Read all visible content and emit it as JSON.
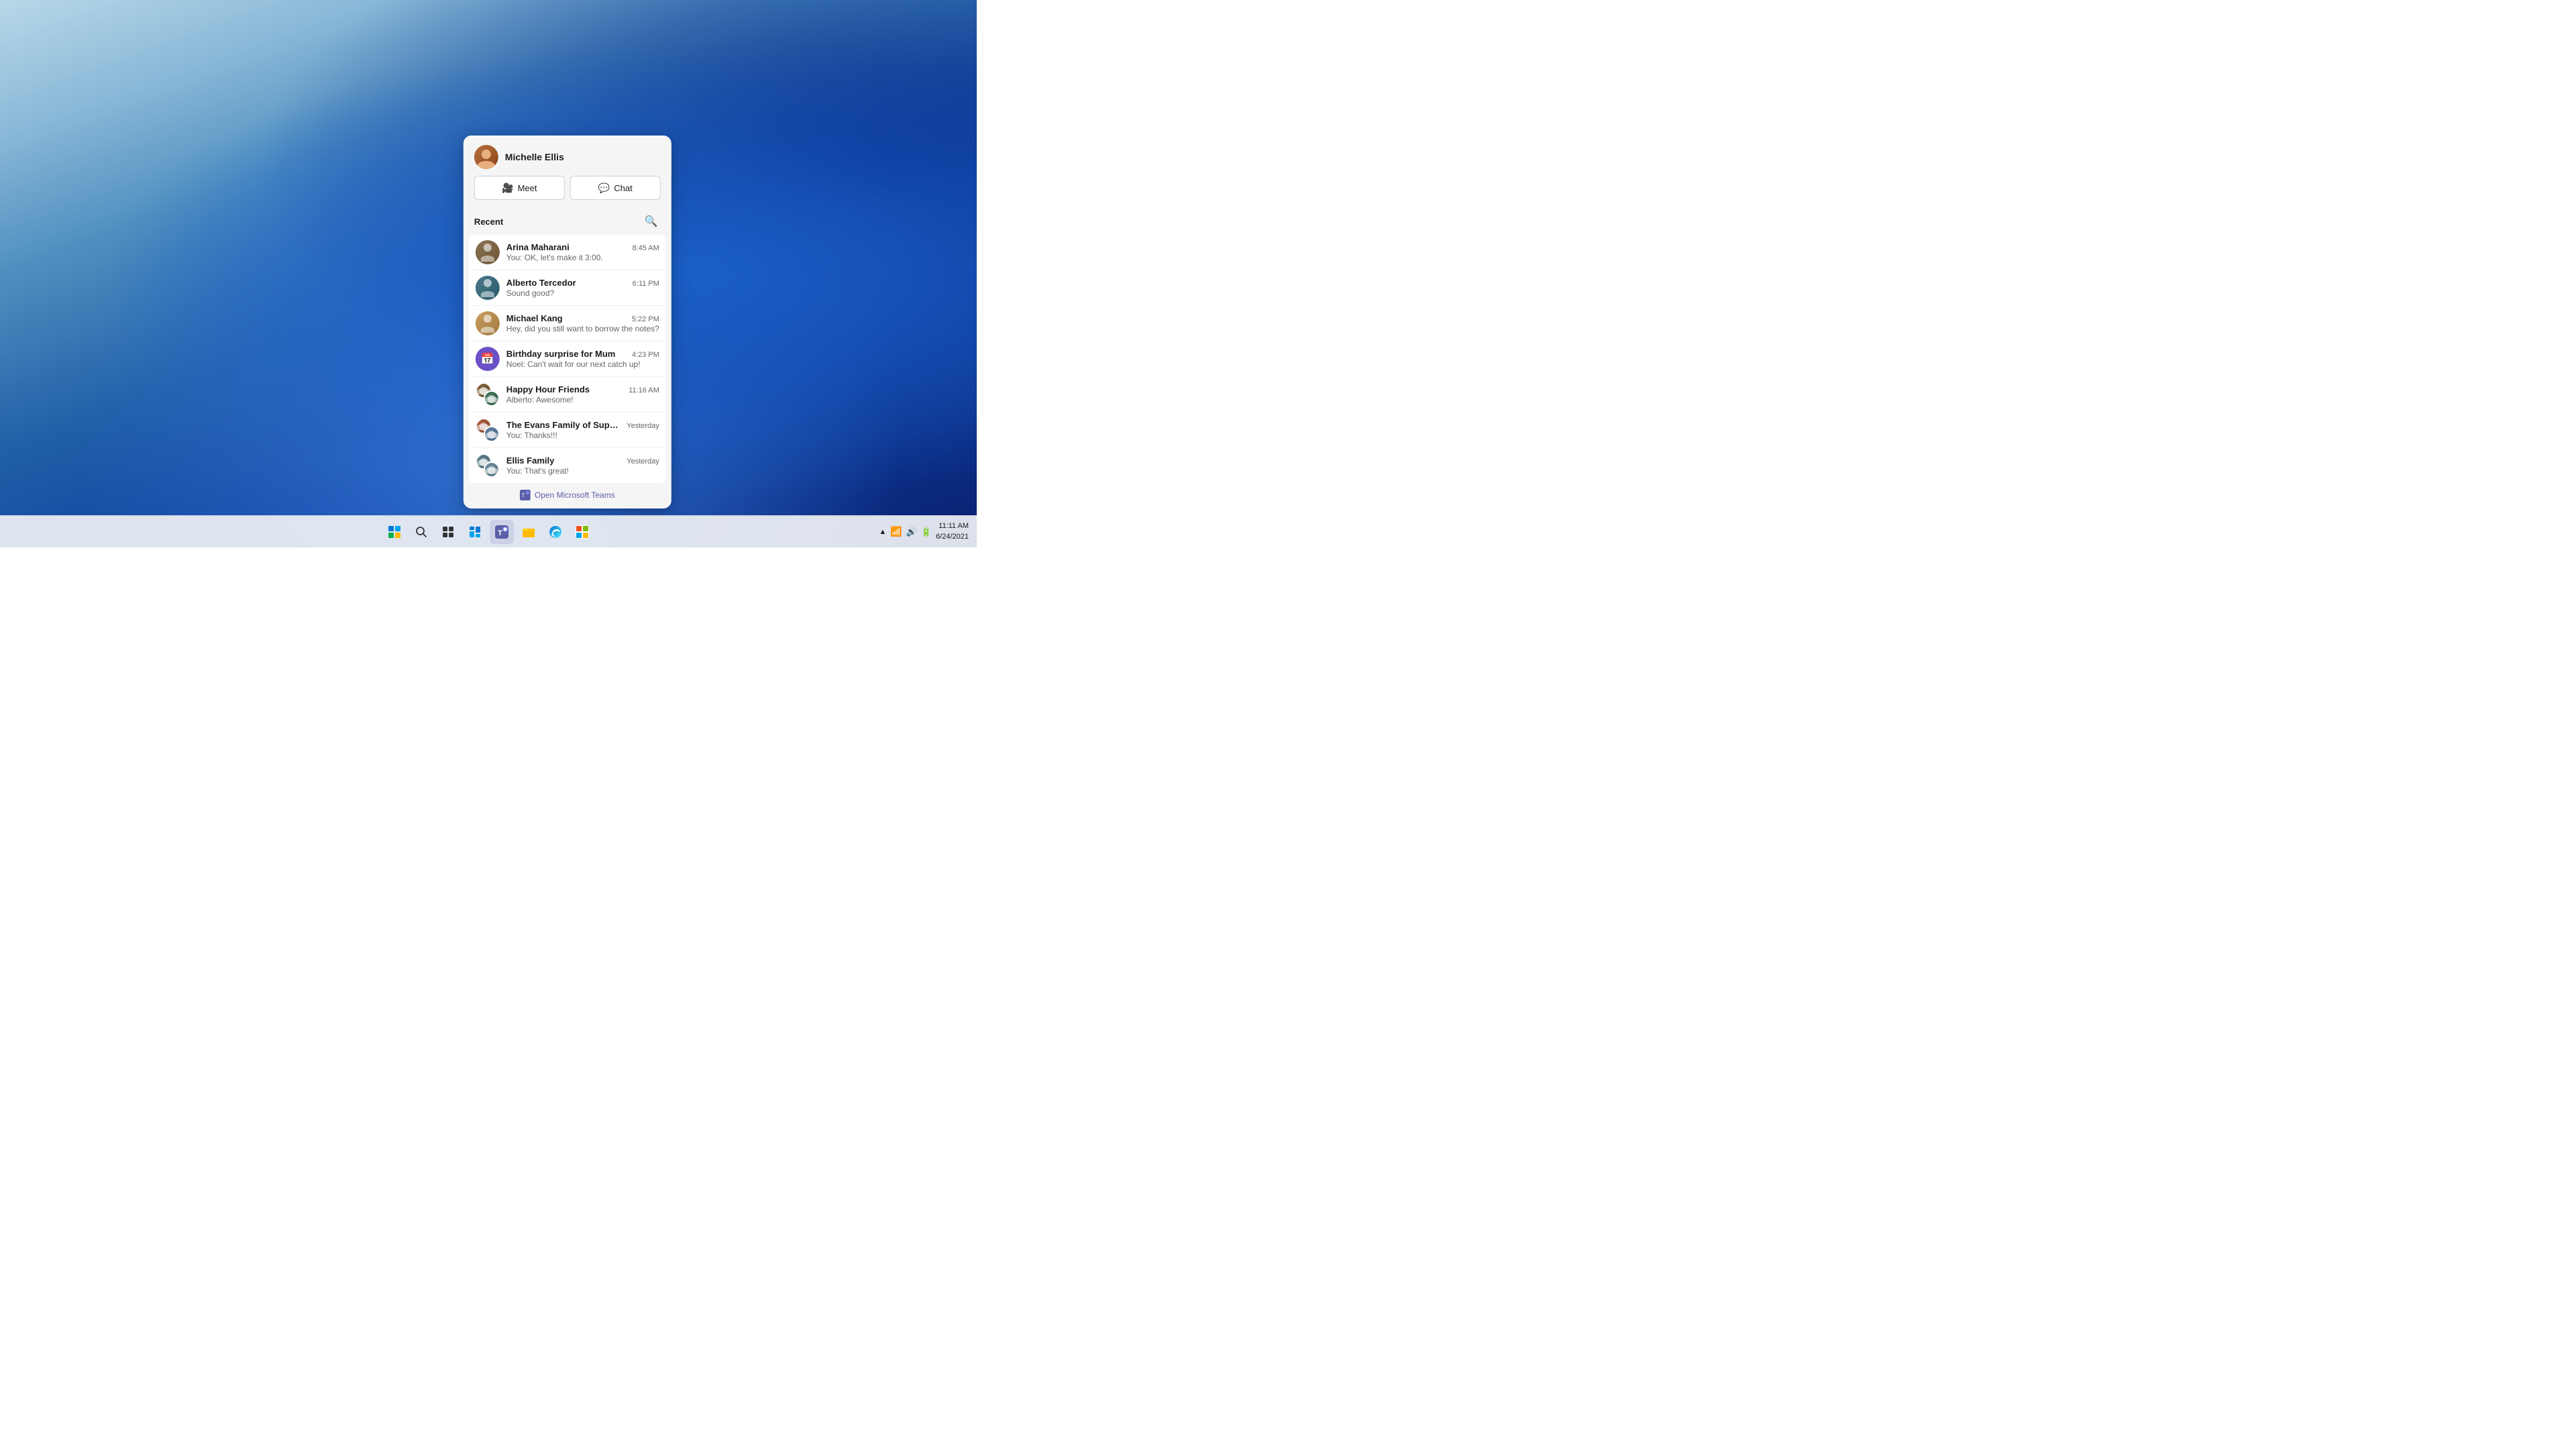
{
  "desktop": {
    "wallpaper_description": "Windows 11 blue flower wallpaper"
  },
  "teams_popup": {
    "user": {
      "name": "Michelle Ellis"
    },
    "buttons": {
      "meet_label": "Meet",
      "chat_label": "Chat"
    },
    "recent_label": "Recent",
    "chat_items": [
      {
        "id": "arina",
        "name": "Arina Maharani",
        "preview": "You: OK, let's make it 3:00.",
        "time": "8:45 AM",
        "avatar_type": "single",
        "avatar_color": "av-arina"
      },
      {
        "id": "alberto-t",
        "name": "Alberto Tercedor",
        "preview": "Sound good?",
        "time": "6:11 PM",
        "avatar_type": "single",
        "avatar_color": "av-alberto"
      },
      {
        "id": "michael",
        "name": "Michael Kang",
        "preview": "Hey, did you still want to borrow the notes?",
        "time": "5:22 PM",
        "avatar_type": "single",
        "avatar_color": "av-michael"
      },
      {
        "id": "birthday",
        "name": "Birthday surprise for Mum",
        "preview": "Noel: Can't wait for our next catch up!",
        "time": "4:23 PM",
        "avatar_type": "calendar",
        "avatar_color": "av-birthday"
      },
      {
        "id": "happy",
        "name": "Happy Hour Friends",
        "preview": "Alberto: Awesome!",
        "time": "11:16 AM",
        "avatar_type": "group",
        "avatar_color": "av-happy"
      },
      {
        "id": "evans",
        "name": "The Evans Family of Supers",
        "preview": "You: Thanks!!!",
        "time": "Yesterday",
        "avatar_type": "group",
        "avatar_color": "av-evans"
      },
      {
        "id": "ellis-family",
        "name": "Ellis Family",
        "preview": "You: That's great!",
        "time": "Yesterday",
        "avatar_type": "group",
        "avatar_color": "av-ellis"
      }
    ],
    "footer": {
      "label": "Open Microsoft Teams"
    }
  },
  "taskbar": {
    "time": "11:11 AM",
    "date": "6/24/2021",
    "icons": [
      {
        "id": "windows",
        "label": "Start"
      },
      {
        "id": "search",
        "label": "Search"
      },
      {
        "id": "taskview",
        "label": "Task View"
      },
      {
        "id": "widgets",
        "label": "Widgets"
      },
      {
        "id": "teams",
        "label": "Teams"
      },
      {
        "id": "explorer",
        "label": "File Explorer"
      },
      {
        "id": "edge",
        "label": "Microsoft Edge"
      },
      {
        "id": "store",
        "label": "Microsoft Store"
      }
    ]
  }
}
